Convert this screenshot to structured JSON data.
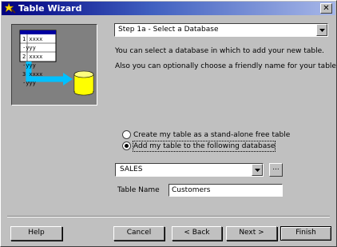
{
  "window": {
    "title": "Table Wizard",
    "close_glyph": "✕"
  },
  "icons": {
    "app": "wizard-wand-icon",
    "close": "close-icon",
    "dropdown": "chevron-down-icon"
  },
  "illustration": {
    "rows": [
      "1  xxxx ·yyy",
      "2  xxxx ·yyy",
      "3  xxxx ·yyy"
    ]
  },
  "step_select": {
    "value": "Step 1a - Select a Database"
  },
  "description": {
    "line1": "You can select a database in which to add your new table.",
    "line2": "Also you can optionally choose a friendly name for your table."
  },
  "radio": {
    "option1": {
      "label": "Create my table as a stand-alone free table",
      "selected": false
    },
    "option2": {
      "label": "Add my table to the following database",
      "selected": true
    }
  },
  "database": {
    "value": "SALES",
    "browse_label": "..."
  },
  "table_name": {
    "label": "Table Name",
    "value": "Customers"
  },
  "buttons": {
    "help": "Help",
    "cancel": "Cancel",
    "back": "< Back",
    "next": "Next >",
    "finish": "Finish"
  },
  "colors": {
    "title_start": "#000080",
    "face": "#c0c0c0",
    "disk": "#ffff00",
    "arrow": "#00c0ff"
  }
}
